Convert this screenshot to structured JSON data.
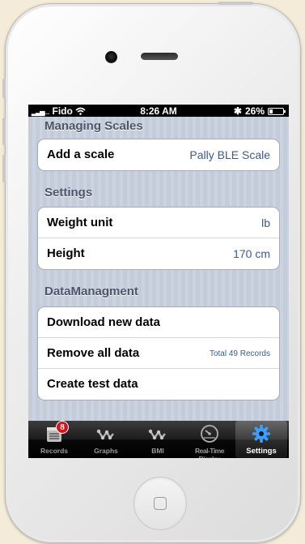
{
  "status_bar": {
    "carrier": "Fido",
    "time": "8:26 AM",
    "battery": "26%"
  },
  "sections": [
    {
      "title": "Managing Scales",
      "rows": [
        {
          "label": "Add a scale",
          "value": "Pally BLE Scale"
        }
      ]
    },
    {
      "title": "Settings",
      "rows": [
        {
          "label": "Weight unit",
          "value": "lb"
        },
        {
          "label": "Height",
          "value": "170 cm"
        }
      ]
    },
    {
      "title": "DataManagment",
      "rows": [
        {
          "label": "Download new data",
          "value": ""
        },
        {
          "label": "Remove all data",
          "value": "Total 49 Records"
        },
        {
          "label": "Create test data",
          "value": ""
        }
      ]
    }
  ],
  "tabbar": {
    "records": {
      "label": "Records",
      "badge": "8",
      "icon": "notepad-icon"
    },
    "graphs": {
      "label": "Graphs",
      "icon": "graph-icon"
    },
    "bmi": {
      "label": "BMI",
      "icon": "graph-icon"
    },
    "realtime": {
      "label": "Real-Time Display",
      "icon": "gauge-icon"
    },
    "settings": {
      "label": "Settings",
      "icon": "gear-icon",
      "active": true
    }
  },
  "colors": {
    "value_text": "#3d5a92",
    "section_header": "#4c566a",
    "badge": "#d8141b",
    "settings_icon": "#3aa0ff"
  }
}
